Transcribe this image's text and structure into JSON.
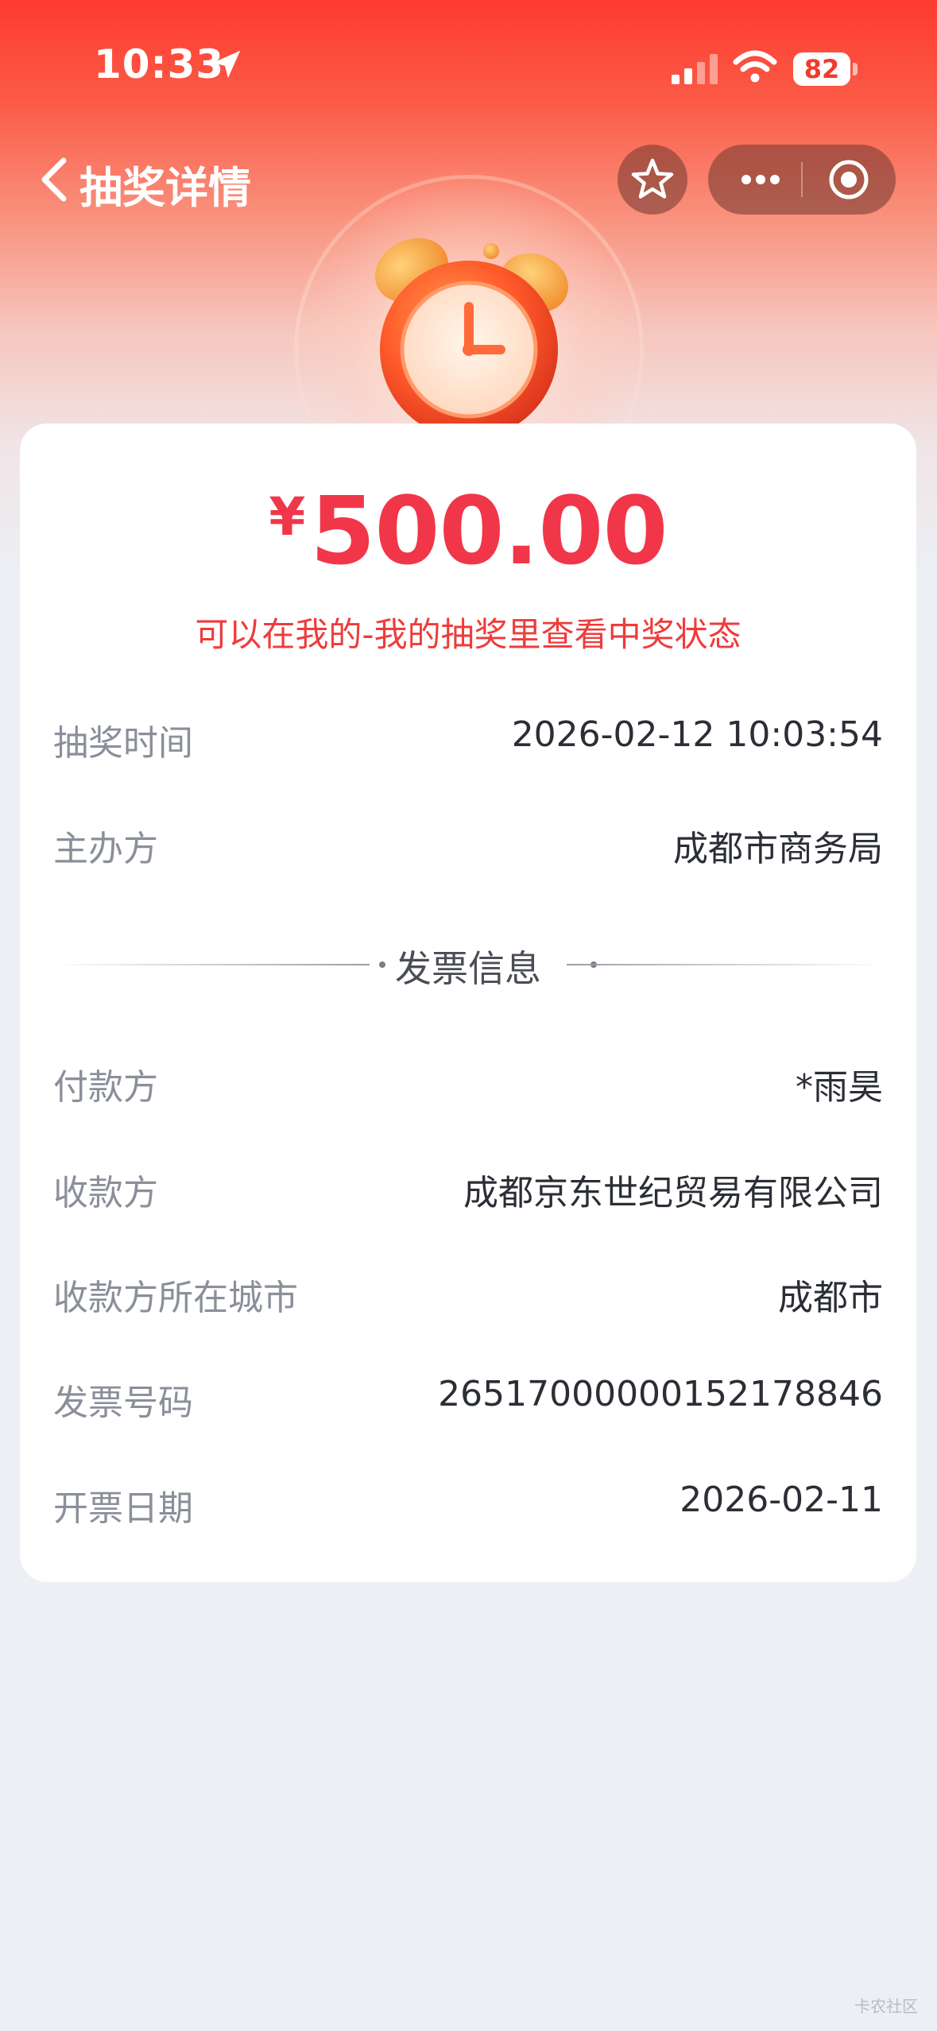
{
  "status_bar": {
    "time": "10:33",
    "battery": "82"
  },
  "nav": {
    "title": "抽奖详情"
  },
  "prize": {
    "currency": "¥",
    "amount": "500.00",
    "notice": "可以在我的-我的抽奖里查看中奖状态"
  },
  "details": [
    {
      "label": "抽奖时间",
      "value": "2026-02-12 10:03:54"
    },
    {
      "label": "主办方",
      "value": "成都市商务局"
    }
  ],
  "invoice": {
    "section_title": "发票信息",
    "rows": [
      {
        "label": "付款方",
        "value": "*雨昊"
      },
      {
        "label": "收款方",
        "value": "成都京东世纪贸易有限公司"
      },
      {
        "label": "收款方所在城市",
        "value": "成都市"
      },
      {
        "label": "发票号码",
        "value": "26517000000152178846"
      },
      {
        "label": "开票日期",
        "value": "2026-02-11"
      }
    ]
  },
  "watermark": "卡农社区",
  "colors": {
    "accent_red": "#f1364a",
    "header_red": "#ff3b30",
    "label_gray": "#8a8f99",
    "value_dark": "#2b2e35",
    "page_bg": "#eceff4"
  },
  "icons": [
    "location-arrow-icon",
    "signal-icon",
    "wifi-icon",
    "battery-icon",
    "chevron-left-icon",
    "star-icon",
    "more-icon",
    "target-icon",
    "alarm-clock-icon"
  ]
}
